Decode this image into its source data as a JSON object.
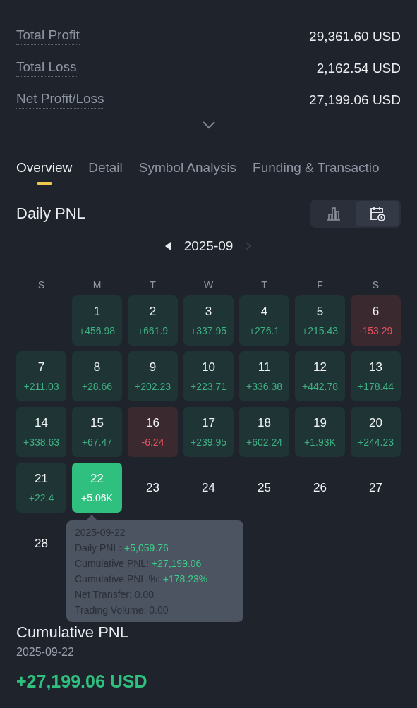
{
  "summary": [
    {
      "label": "Total Profit",
      "value": "29,361.60 USD"
    },
    {
      "label": "Total Loss",
      "value": "2,162.54 USD"
    },
    {
      "label": "Net Profit/Loss",
      "value": "27,199.06 USD"
    }
  ],
  "tabs": [
    {
      "label": "Overview",
      "selected": true
    },
    {
      "label": "Detail",
      "selected": false
    },
    {
      "label": "Symbol Analysis",
      "selected": false
    },
    {
      "label": "Funding & Transactio",
      "selected": false
    }
  ],
  "daily_pnl": {
    "title": "Daily PNL",
    "view_toggle": [
      {
        "kind": "chart",
        "selected": false
      },
      {
        "kind": "calendar",
        "selected": true
      }
    ],
    "month": "2025-09",
    "next_disabled": true,
    "weekdays": [
      "S",
      "M",
      "T",
      "W",
      "T",
      "F",
      "S"
    ],
    "days": [
      {
        "day": "1",
        "pnl": "+456.98",
        "kind": "profit",
        "selected": false
      },
      {
        "day": "2",
        "pnl": "+661.9",
        "kind": "profit",
        "selected": false
      },
      {
        "day": "3",
        "pnl": "+337.95",
        "kind": "profit",
        "selected": false
      },
      {
        "day": "4",
        "pnl": "+276.1",
        "kind": "profit",
        "selected": false
      },
      {
        "day": "5",
        "pnl": "+215.43",
        "kind": "profit",
        "selected": false
      },
      {
        "day": "6",
        "pnl": "-153.29",
        "kind": "loss",
        "selected": false
      },
      {
        "day": "7",
        "pnl": "+211.03",
        "kind": "profit",
        "selected": false
      },
      {
        "day": "8",
        "pnl": "+28.66",
        "kind": "profit",
        "selected": false
      },
      {
        "day": "9",
        "pnl": "+202.23",
        "kind": "profit",
        "selected": false
      },
      {
        "day": "10",
        "pnl": "+223.71",
        "kind": "profit",
        "selected": false
      },
      {
        "day": "11",
        "pnl": "+336.38",
        "kind": "profit",
        "selected": false
      },
      {
        "day": "12",
        "pnl": "+442.78",
        "kind": "profit",
        "selected": false
      },
      {
        "day": "13",
        "pnl": "+178.44",
        "kind": "profit",
        "selected": false
      },
      {
        "day": "14",
        "pnl": "+338.63",
        "kind": "profit",
        "selected": false
      },
      {
        "day": "15",
        "pnl": "+67.47",
        "kind": "profit",
        "selected": false
      },
      {
        "day": "16",
        "pnl": "-6.24",
        "kind": "loss",
        "selected": false
      },
      {
        "day": "17",
        "pnl": "+239.95",
        "kind": "profit",
        "selected": false
      },
      {
        "day": "18",
        "pnl": "+602.24",
        "kind": "profit",
        "selected": false
      },
      {
        "day": "19",
        "pnl": "+1.93K",
        "kind": "profit",
        "selected": false
      },
      {
        "day": "20",
        "pnl": "+244.23",
        "kind": "profit",
        "selected": false
      },
      {
        "day": "21",
        "pnl": "+22.4",
        "kind": "profit",
        "selected": false
      },
      {
        "day": "22",
        "pnl": "+5.06K",
        "kind": "profit",
        "selected": true
      },
      {
        "day": "23",
        "kind": "none",
        "selected": false
      },
      {
        "day": "24",
        "kind": "none",
        "selected": false
      },
      {
        "day": "25",
        "kind": "none",
        "selected": false
      },
      {
        "day": "26",
        "kind": "none",
        "selected": false
      },
      {
        "day": "27",
        "kind": "none",
        "selected": false
      },
      {
        "day": "28",
        "kind": "none",
        "selected": false
      }
    ],
    "tooltip": {
      "date": "2025-09-22",
      "lines": [
        {
          "label": "Daily PNL:",
          "value": "+5,059.76",
          "kind": "positive"
        },
        {
          "label": "Cumulative PNL:",
          "value": "+27,199.06",
          "kind": "positive"
        },
        {
          "label": "Cumulative PNL %:",
          "value": "+178.23%",
          "kind": "positive"
        },
        {
          "label": "Net Transfer:",
          "value": "0.00",
          "kind": "neutral"
        },
        {
          "label": "Trading Volume:",
          "value": "0.00",
          "kind": "neutral"
        }
      ]
    }
  },
  "cumulative": {
    "title": "Cumulative PNL",
    "date": "2025-09-22",
    "value": "+27,199.06 USD"
  }
}
